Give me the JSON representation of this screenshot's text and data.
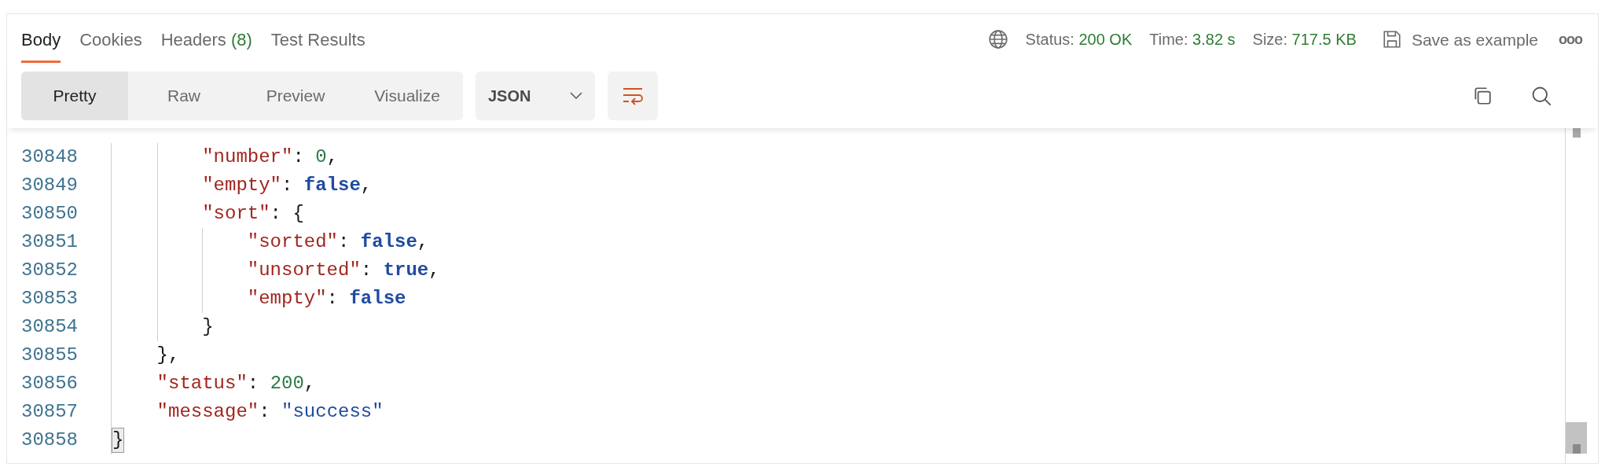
{
  "tabs": [
    {
      "label": "Body",
      "selected": true
    },
    {
      "label": "Cookies",
      "selected": false
    },
    {
      "label": "Headers",
      "count": "(8)",
      "selected": false
    },
    {
      "label": "Test Results",
      "selected": false
    }
  ],
  "response_meta": {
    "status_label": "Status:",
    "status": "200 OK",
    "time_label": "Time:",
    "time": "3.82 s",
    "size_label": "Size:",
    "size": "717.5 KB",
    "save_button": "Save as example",
    "more": "ooo"
  },
  "view_modes": [
    {
      "label": "Pretty",
      "selected": true
    },
    {
      "label": "Raw",
      "selected": false
    },
    {
      "label": "Preview",
      "selected": false
    },
    {
      "label": "Visualize",
      "selected": false
    }
  ],
  "format": "JSON",
  "code_lines": [
    {
      "children": [
        {
          "children": [
            {
              "number": "30848",
              "tokens": [
                {
                  "kind": "key",
                  "text": "\"number\""
                },
                {
                  "kind": "punct",
                  "text": ": "
                },
                {
                  "kind": "number",
                  "text": "0"
                },
                {
                  "kind": "punct",
                  "text": ","
                }
              ]
            },
            {
              "number": "30849",
              "tokens": [
                {
                  "kind": "key",
                  "text": "\"empty\""
                },
                {
                  "kind": "punct",
                  "text": ": "
                },
                {
                  "kind": "boolean",
                  "text": "false"
                },
                {
                  "kind": "punct",
                  "text": ","
                }
              ]
            },
            {
              "number": "30850",
              "tokens": [
                {
                  "kind": "key",
                  "text": "\"sort\""
                },
                {
                  "kind": "punct",
                  "text": ": {"
                }
              ],
              "children": [
                {
                  "number": "30851",
                  "tokens": [
                    {
                      "kind": "key",
                      "text": "\"sorted\""
                    },
                    {
                      "kind": "punct",
                      "text": ": "
                    },
                    {
                      "kind": "boolean",
                      "text": "false"
                    },
                    {
                      "kind": "punct",
                      "text": ","
                    }
                  ]
                },
                {
                  "number": "30852",
                  "tokens": [
                    {
                      "kind": "key",
                      "text": "\"unsorted\""
                    },
                    {
                      "kind": "punct",
                      "text": ": "
                    },
                    {
                      "kind": "boolean",
                      "text": "true"
                    },
                    {
                      "kind": "punct",
                      "text": ","
                    }
                  ]
                },
                {
                  "number": "30853",
                  "tokens": [
                    {
                      "kind": "key",
                      "text": "\"empty\""
                    },
                    {
                      "kind": "punct",
                      "text": ": "
                    },
                    {
                      "kind": "boolean",
                      "text": "false"
                    }
                  ]
                }
              ]
            },
            {
              "number": "30854",
              "tokens": [
                {
                  "kind": "punct",
                  "text": "}"
                }
              ]
            }
          ]
        },
        {
          "number": "30855",
          "tokens": [
            {
              "kind": "punct",
              "text": "},"
            }
          ]
        },
        {
          "number": "30856",
          "tokens": [
            {
              "kind": "key",
              "text": "\"status\""
            },
            {
              "kind": "punct",
              "text": ": "
            },
            {
              "kind": "number",
              "text": "200"
            },
            {
              "kind": "punct",
              "text": ","
            }
          ]
        },
        {
          "number": "30857",
          "tokens": [
            {
              "kind": "key",
              "text": "\"message\""
            },
            {
              "kind": "punct",
              "text": ": "
            },
            {
              "kind": "string",
              "text": "\"success\""
            }
          ]
        }
      ]
    },
    {
      "number": "30858",
      "tokens": [
        {
          "kind": "punct",
          "text": "}",
          "matched": true
        }
      ]
    }
  ]
}
